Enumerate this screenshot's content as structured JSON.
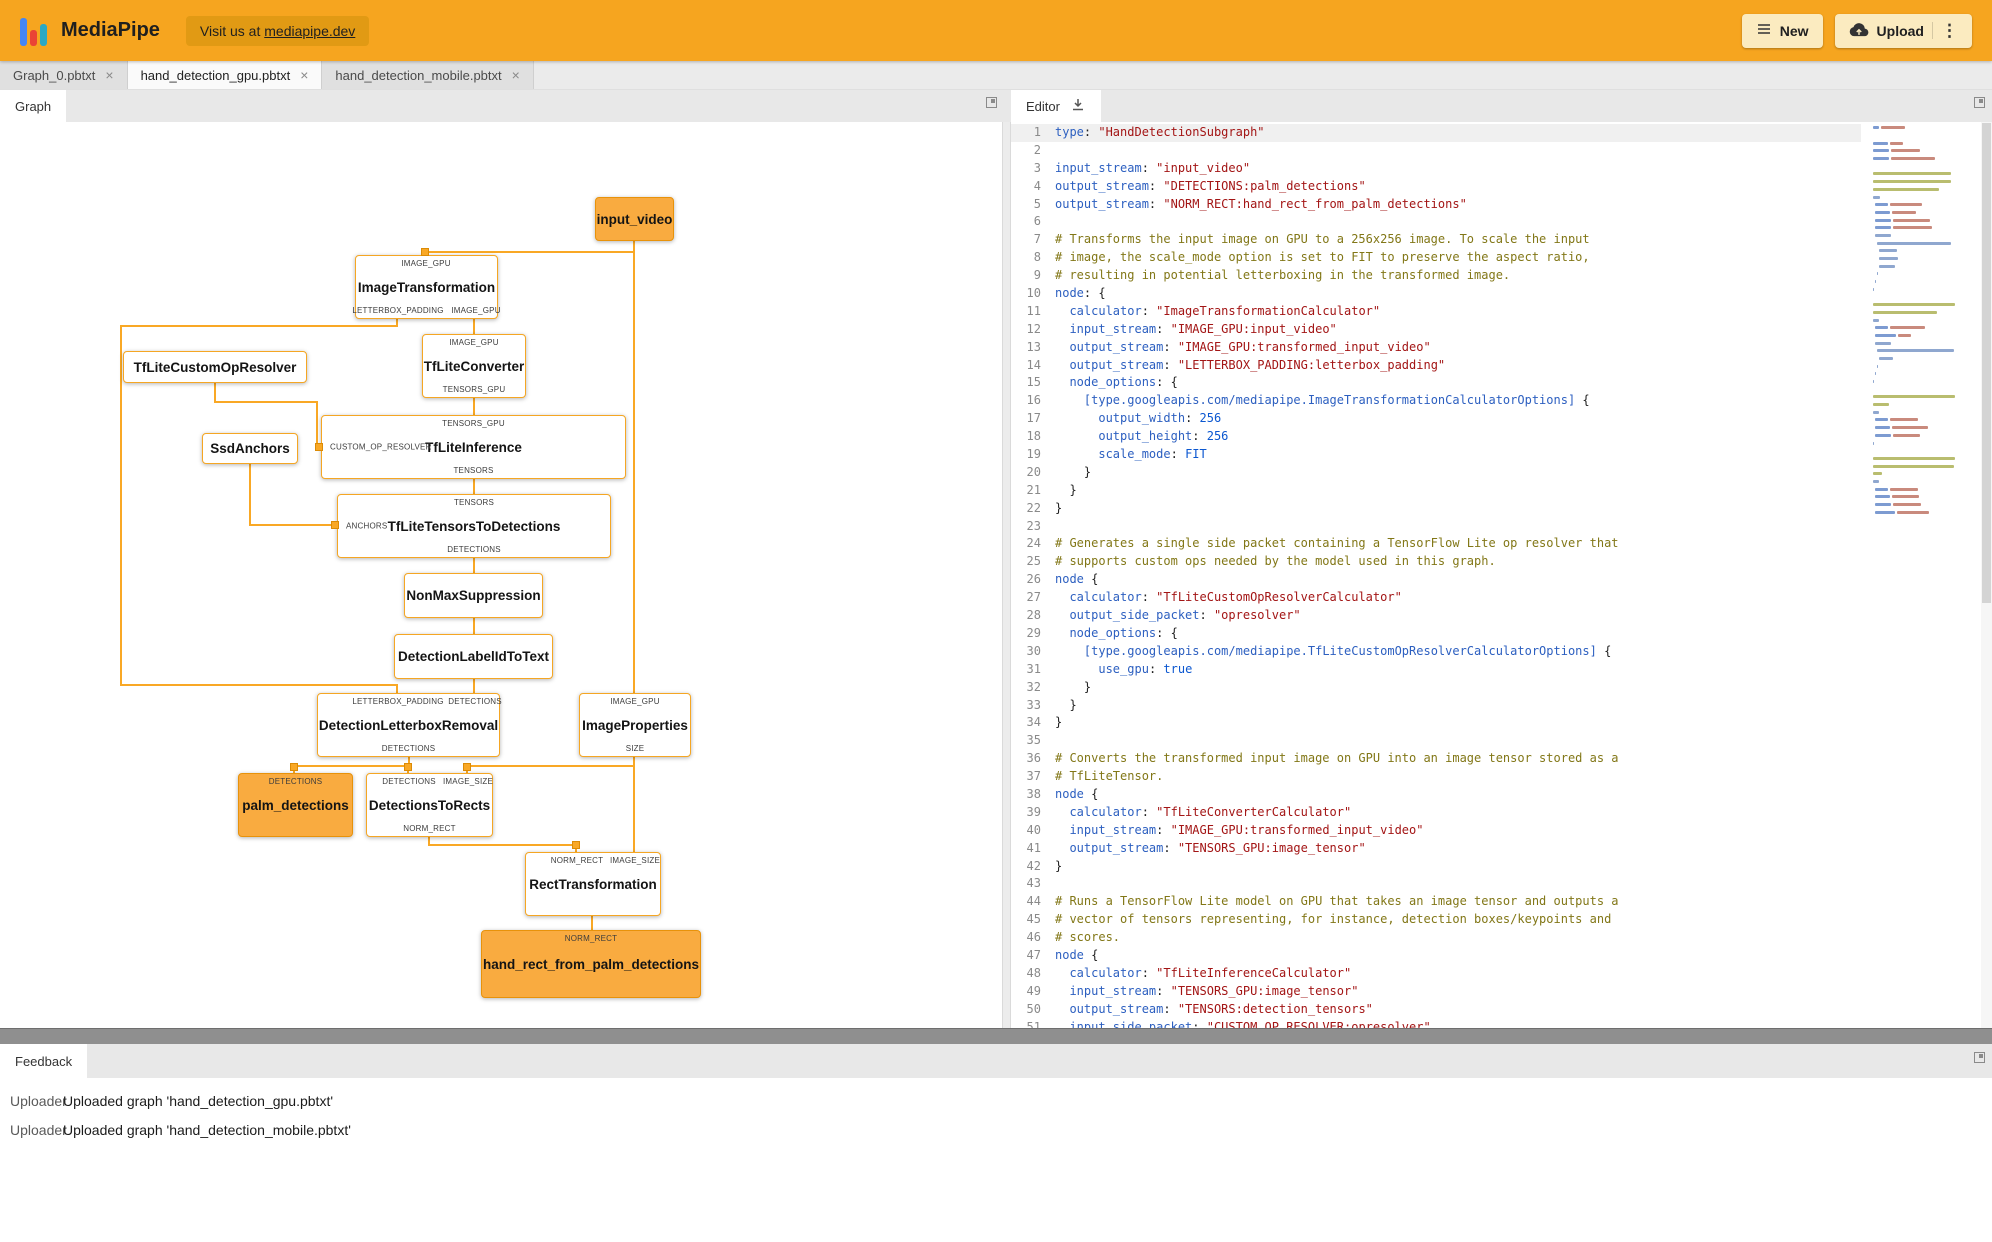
{
  "header": {
    "brand": "MediaPipe",
    "visit_prefix": "Visit us at ",
    "visit_link": "mediapipe.dev",
    "new_label": "New",
    "upload_label": "Upload"
  },
  "file_tabs": [
    {
      "label": "Graph_0.pbtxt"
    },
    {
      "label": "hand_detection_gpu.pbtxt"
    },
    {
      "label": "hand_detection_mobile.pbtxt"
    }
  ],
  "graph_panel": {
    "tab_label": "Graph"
  },
  "editor_panel": {
    "tab_label": "Editor"
  },
  "feedback_panel": {
    "tab_label": "Feedback",
    "rows": [
      {
        "source": "Uploader",
        "message": "Uploaded graph 'hand_detection_gpu.pbtxt'"
      },
      {
        "source": "Uploader",
        "message": "Uploaded graph 'hand_detection_mobile.pbtxt'"
      }
    ]
  },
  "graph": {
    "nodes": {
      "input_video": {
        "label": "input_video"
      },
      "image_transformation": {
        "label": "ImageTransformation",
        "top_ports": [
          "IMAGE_GPU"
        ],
        "bottom_ports": [
          "LETTERBOX_PADDING",
          "IMAGE_GPU"
        ]
      },
      "tflite_converter": {
        "label": "TfLiteConverter",
        "top_ports": [
          "IMAGE_GPU"
        ],
        "bottom_ports": [
          "TENSORS_GPU"
        ]
      },
      "tflite_custom_op_resolver": {
        "label": "TfLiteCustomOpResolver"
      },
      "ssd_anchors": {
        "label": "SsdAnchors"
      },
      "tflite_inference": {
        "label": "TfLiteInference",
        "top_ports": [
          "TENSORS_GPU"
        ],
        "left_ports": [
          "CUSTOM_OP_RESOLVER"
        ],
        "bottom_ports": [
          "TENSORS"
        ]
      },
      "tflite_tensors_to_detections": {
        "label": "TfLiteTensorsToDetections",
        "top_ports": [
          "TENSORS"
        ],
        "left_ports": [
          "ANCHORS"
        ],
        "bottom_ports": [
          "DETECTIONS"
        ]
      },
      "non_max_suppression": {
        "label": "NonMaxSuppression"
      },
      "detection_label_id_to_text": {
        "label": "DetectionLabelIdToText"
      },
      "detection_letterbox_removal": {
        "label": "DetectionLetterboxRemoval",
        "top_ports": [
          "LETTERBOX_PADDING",
          "DETECTIONS"
        ],
        "bottom_ports": [
          "DETECTIONS"
        ]
      },
      "image_properties": {
        "label": "ImageProperties",
        "top_ports": [
          "IMAGE_GPU"
        ],
        "bottom_ports": [
          "SIZE"
        ]
      },
      "palm_detections": {
        "label": "palm_detections",
        "top_ports": [
          "DETECTIONS"
        ]
      },
      "detections_to_rects": {
        "label": "DetectionsToRects",
        "top_ports": [
          "DETECTIONS",
          "IMAGE_SIZE"
        ],
        "bottom_ports": [
          "NORM_RECT"
        ]
      },
      "rect_transformation": {
        "label": "RectTransformation",
        "top_ports": [
          "NORM_RECT",
          "IMAGE_SIZE"
        ]
      },
      "hand_rect_from_palm_detections": {
        "label": "hand_rect_from_palm_detections",
        "top_ports": [
          "NORM_RECT"
        ]
      }
    }
  },
  "code": {
    "lines": [
      "type: \"HandDetectionSubgraph\"",
      "",
      "input_stream: \"input_video\"",
      "output_stream: \"DETECTIONS:palm_detections\"",
      "output_stream: \"NORM_RECT:hand_rect_from_palm_detections\"",
      "",
      "# Transforms the input image on GPU to a 256x256 image. To scale the input",
      "# image, the scale_mode option is set to FIT to preserve the aspect ratio,",
      "# resulting in potential letterboxing in the transformed image.",
      "node: {",
      "  calculator: \"ImageTransformationCalculator\"",
      "  input_stream: \"IMAGE_GPU:input_video\"",
      "  output_stream: \"IMAGE_GPU:transformed_input_video\"",
      "  output_stream: \"LETTERBOX_PADDING:letterbox_padding\"",
      "  node_options: {",
      "    [type.googleapis.com/mediapipe.ImageTransformationCalculatorOptions] {",
      "      output_width: 256",
      "      output_height: 256",
      "      scale_mode: FIT",
      "    }",
      "  }",
      "}",
      "",
      "# Generates a single side packet containing a TensorFlow Lite op resolver that",
      "# supports custom ops needed by the model used in this graph.",
      "node {",
      "  calculator: \"TfLiteCustomOpResolverCalculator\"",
      "  output_side_packet: \"opresolver\"",
      "  node_options: {",
      "    [type.googleapis.com/mediapipe.TfLiteCustomOpResolverCalculatorOptions] {",
      "      use_gpu: true",
      "    }",
      "  }",
      "}",
      "",
      "# Converts the transformed input image on GPU into an image tensor stored as a",
      "# TfLiteTensor.",
      "node {",
      "  calculator: \"TfLiteConverterCalculator\"",
      "  input_stream: \"IMAGE_GPU:transformed_input_video\"",
      "  output_stream: \"TENSORS_GPU:image_tensor\"",
      "}",
      "",
      "# Runs a TensorFlow Lite model on GPU that takes an image tensor and outputs a",
      "# vector of tensors representing, for instance, detection boxes/keypoints and",
      "# scores.",
      "node {",
      "  calculator: \"TfLiteInferenceCalculator\"",
      "  input_stream: \"TENSORS_GPU:image_tensor\"",
      "  output_stream: \"TENSORS:detection_tensors\"",
      "  input_side_packet: \"CUSTOM_OP_RESOLVER:opresolver\""
    ]
  },
  "colors": {
    "header_bg": "#F6A51F",
    "graph_accent": "#F9A825",
    "output_node_bg": "#F9AB40",
    "code_key": "#2C5FC0",
    "code_string": "#A31515",
    "code_comment": "#827717",
    "code_value": "#0B57D0"
  }
}
